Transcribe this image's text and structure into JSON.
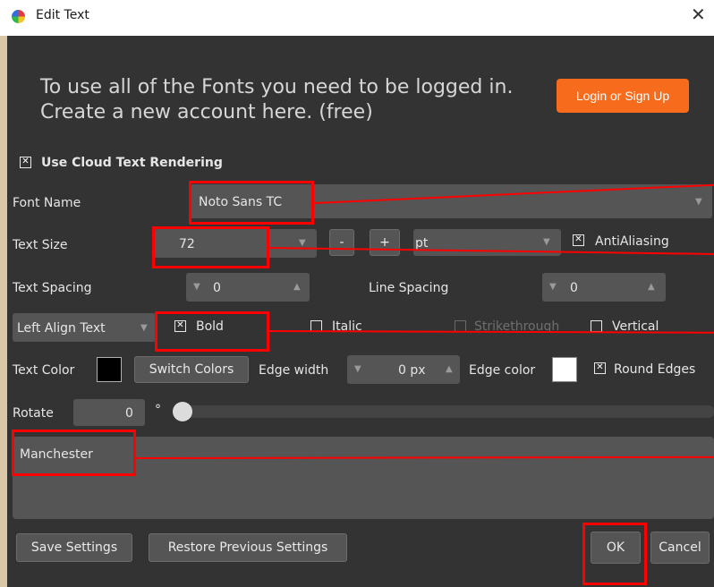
{
  "window": {
    "title": "Edit Text",
    "close_glyph": "✕"
  },
  "banner": {
    "line1": "To use all of the Fonts you need to be logged in.",
    "line2": "Create a new account here. (free)",
    "login_label": "Login or Sign Up"
  },
  "cloud_rendering": {
    "label": "Use Cloud Text Rendering",
    "checked": true
  },
  "font_name": {
    "label": "Font Name",
    "value": "Noto Sans TC"
  },
  "text_size": {
    "label": "Text Size",
    "value": "72",
    "minus": "-",
    "plus": "+",
    "unit": "pt",
    "antialias_label": "AntiAliasing",
    "antialias_checked": true
  },
  "spacing": {
    "text_label": "Text Spacing",
    "text_value": "0",
    "line_label": "Line Spacing",
    "line_value": "0"
  },
  "style": {
    "align_value": "Left Align Text",
    "bold_label": "Bold",
    "bold_checked": true,
    "italic_label": "Italic",
    "strike_label": "Strikethrough",
    "vertical_label": "Vertical"
  },
  "color_row": {
    "text_color_label": "Text Color",
    "text_color": "#000000",
    "switch_label": "Switch Colors",
    "edge_width_label": "Edge width",
    "edge_width_value": "0 px",
    "edge_color_label": "Edge color",
    "edge_color": "#ffffff",
    "round_edges_label": "Round Edges"
  },
  "rotate": {
    "label": "Rotate",
    "value": "0",
    "degree": "°",
    "fraction": 0
  },
  "text_content": "Manchester",
  "footer": {
    "save_label": "Save Settings",
    "restore_label": "Restore Previous Settings",
    "ok_label": "OK",
    "cancel_label": "Cancel"
  },
  "colors": {
    "annotation": "#ff0000",
    "accent": "#f76b1c",
    "dialog_bg": "#333333"
  }
}
